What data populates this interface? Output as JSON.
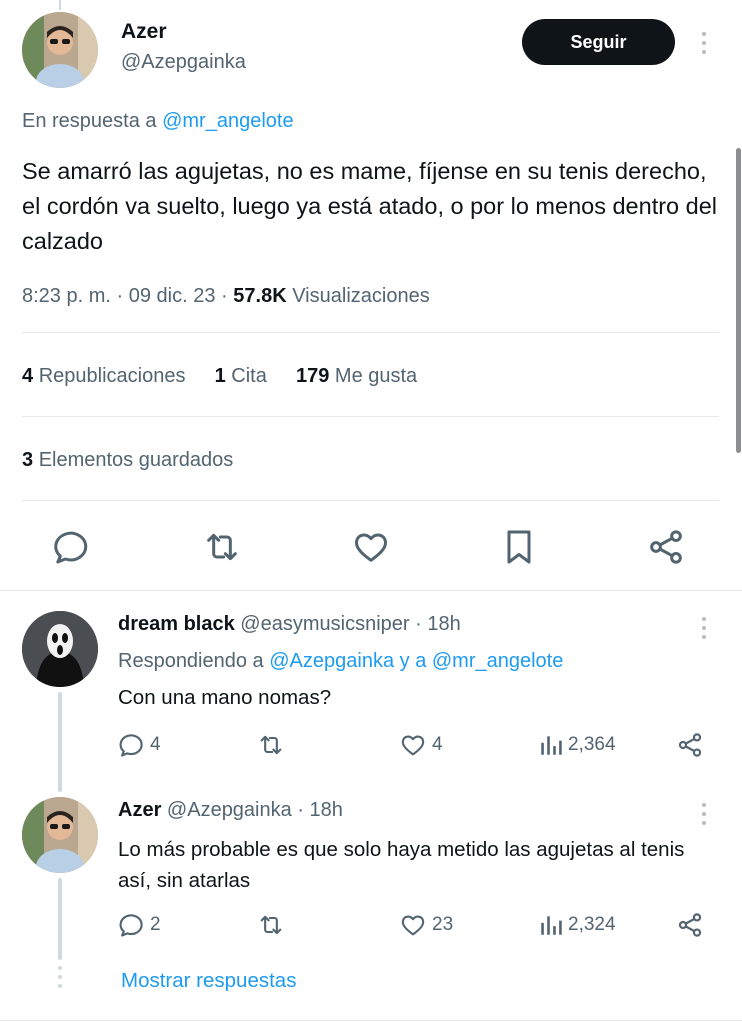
{
  "main_tweet": {
    "author_name": "Azer",
    "author_handle": "@Azepgainka",
    "follow_label": "Seguir",
    "reply_prefix": "En respuesta a",
    "reply_to": "@mr_angelote",
    "text": "Se amarró las agujetas, no es mame, fíjense en su tenis derecho, el cordón va suelto, luego ya está atado, o por lo menos dentro del calzado",
    "time": "8:23 p. m.",
    "date": "09 dic. 23",
    "views_count": "57.8K",
    "views_label": "Visualizaciones",
    "retweets_count": "4",
    "retweets_label": "Republicaciones",
    "quotes_count": "1",
    "quotes_label": "Cita",
    "likes_count": "179",
    "likes_label": "Me gusta",
    "bookmarks_count": "3",
    "bookmarks_label": "Elementos guardados",
    "icons": [
      "reply-icon",
      "retweet-icon",
      "like-icon",
      "bookmark-icon",
      "share-icon"
    ]
  },
  "replies": [
    {
      "name": "dream black",
      "handle": "@easymusicsniper",
      "time": "18h",
      "replying_prefix": "Respondiendo a",
      "replying_to": "@Azepgainka y a @mr_angelote",
      "text": "Con una mano nomas?",
      "reply_count": "4",
      "like_count": "4",
      "view_count": "2,364"
    },
    {
      "name": "Azer",
      "handle": "@Azepgainka",
      "time": "18h",
      "text": "Lo más probable es que solo haya metido las agujetas al tenis así, sin atarlas",
      "reply_count": "2",
      "like_count": "23",
      "view_count": "2,324"
    }
  ],
  "show_replies_label": "Mostrar respuestas",
  "separator_dot": "·",
  "colors": {
    "accent": "#1d9bf0",
    "text": "#0f1419",
    "secondary": "#536471",
    "follow_bg": "#0f1419"
  }
}
